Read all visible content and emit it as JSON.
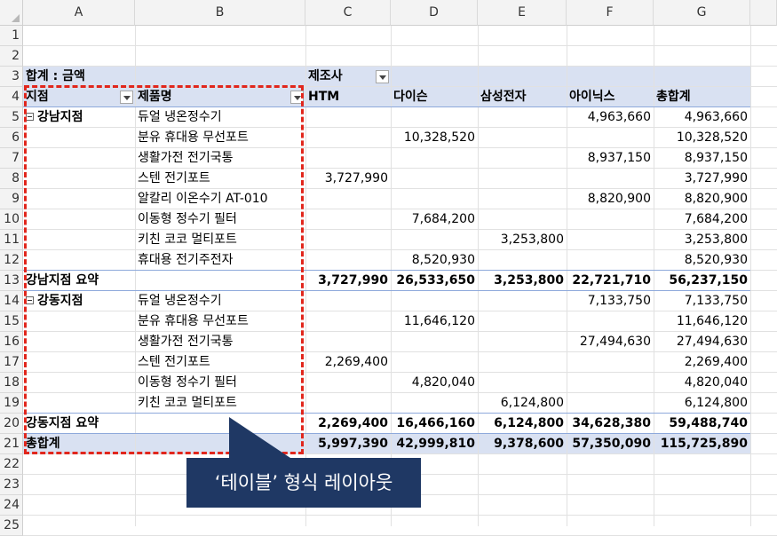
{
  "columns": [
    "A",
    "B",
    "C",
    "D",
    "E",
    "F",
    "G"
  ],
  "rows": [
    "1",
    "2",
    "3",
    "4",
    "5",
    "6",
    "7",
    "8",
    "9",
    "10",
    "11",
    "12",
    "13",
    "14",
    "15",
    "16",
    "17",
    "18",
    "19",
    "20",
    "21",
    "22",
    "23",
    "24",
    "25"
  ],
  "pivot": {
    "sum_label": "합계 : 금액",
    "col_field": "제조사",
    "row_field1": "지점",
    "row_field2": "제품명",
    "manufacturers": [
      "HTM",
      "다이슨",
      "삼성전자",
      "아이닉스",
      "총합계"
    ],
    "groups": [
      {
        "name": "강남지점",
        "items": [
          {
            "product": "듀얼 냉온정수기",
            "values": [
              "",
              "",
              "",
              "4,963,660",
              "4,963,660"
            ]
          },
          {
            "product": "분유 휴대용 무선포트",
            "values": [
              "",
              "10,328,520",
              "",
              "",
              "10,328,520"
            ]
          },
          {
            "product": "생활가전 전기국통",
            "values": [
              "",
              "",
              "",
              "8,937,150",
              "8,937,150"
            ]
          },
          {
            "product": "스텐 전기포트",
            "values": [
              "3,727,990",
              "",
              "",
              "",
              "3,727,990"
            ]
          },
          {
            "product": "알칼리 이온수기 AT-010",
            "values": [
              "",
              "",
              "",
              "8,820,900",
              "8,820,900"
            ]
          },
          {
            "product": "이동형 정수기 필터",
            "values": [
              "",
              "7,684,200",
              "",
              "",
              "7,684,200"
            ]
          },
          {
            "product": "키친 코코 멀티포트",
            "values": [
              "",
              "",
              "3,253,800",
              "",
              "3,253,800"
            ]
          },
          {
            "product": "휴대용 전기주전자",
            "values": [
              "",
              "8,520,930",
              "",
              "",
              "8,520,930"
            ]
          }
        ],
        "subtotal_label": "강남지점 요약",
        "subtotal": [
          "3,727,990",
          "26,533,650",
          "3,253,800",
          "22,721,710",
          "56,237,150"
        ]
      },
      {
        "name": "강동지점",
        "items": [
          {
            "product": "듀얼 냉온정수기",
            "values": [
              "",
              "",
              "",
              "7,133,750",
              "7,133,750"
            ]
          },
          {
            "product": "분유 휴대용 무선포트",
            "values": [
              "",
              "11,646,120",
              "",
              "",
              "11,646,120"
            ]
          },
          {
            "product": "생활가전 전기국통",
            "values": [
              "",
              "",
              "",
              "27,494,630",
              "27,494,630"
            ]
          },
          {
            "product": "스텐 전기포트",
            "values": [
              "2,269,400",
              "",
              "",
              "",
              "2,269,400"
            ]
          },
          {
            "product": "이동형 정수기 필터",
            "values": [
              "",
              "4,820,040",
              "",
              "",
              "4,820,040"
            ]
          },
          {
            "product": "키친 코코 멀티포트",
            "values": [
              "",
              "",
              "6,124,800",
              "",
              "6,124,800"
            ]
          }
        ],
        "subtotal_label": "강동지점 요약",
        "subtotal": [
          "2,269,400",
          "16,466,160",
          "6,124,800",
          "34,628,380",
          "59,488,740"
        ]
      }
    ],
    "grand_label": "총합계",
    "grand": [
      "5,997,390",
      "42,999,810",
      "9,378,600",
      "57,350,090",
      "115,725,890"
    ]
  },
  "callout": "‘테이블’ 형식 레이아웃",
  "colors": {
    "band": "#d9e1f2",
    "highlight": "#e1261c",
    "callout": "#1f3864"
  }
}
